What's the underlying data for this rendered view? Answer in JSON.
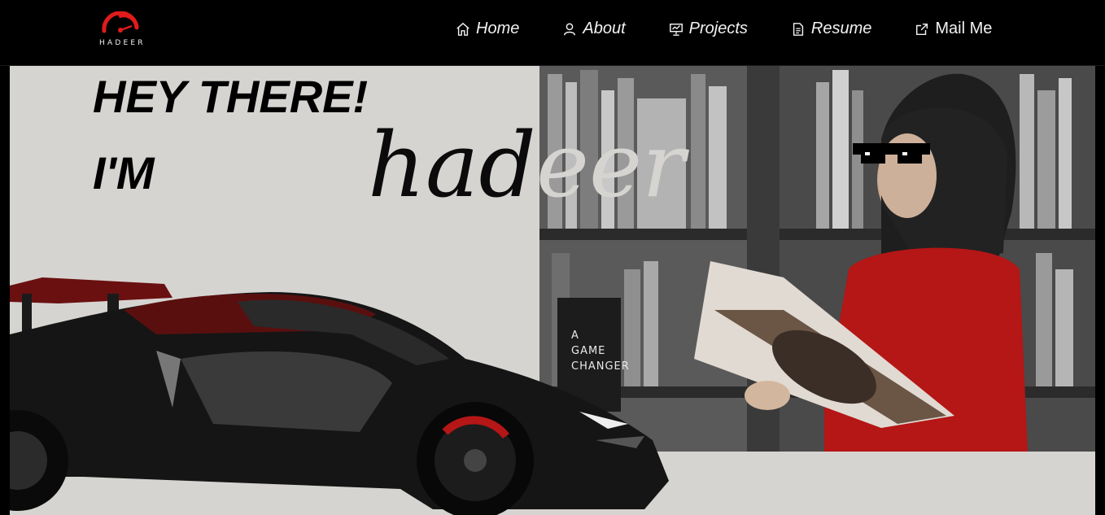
{
  "logo": {
    "text": "HADEER",
    "accent": "#e01b1b"
  },
  "nav": {
    "items": [
      {
        "label": "Home",
        "icon": "home-icon"
      },
      {
        "label": "About",
        "icon": "user-icon"
      },
      {
        "label": "Projects",
        "icon": "presentation-icon"
      },
      {
        "label": "Resume",
        "icon": "document-icon"
      },
      {
        "label": "Mail Me",
        "icon": "external-link-icon"
      }
    ]
  },
  "hero": {
    "greeting": "HEY THERE!",
    "intro": "I'M",
    "name_dark": "had",
    "name_light": "eer",
    "book_lines": [
      "A",
      "GAME",
      "CHANGER"
    ]
  },
  "colors": {
    "background": "#000000",
    "hero_background": "#d6d4d1",
    "accent": "#e01b1b",
    "nav_text": "#f2f2f2"
  }
}
